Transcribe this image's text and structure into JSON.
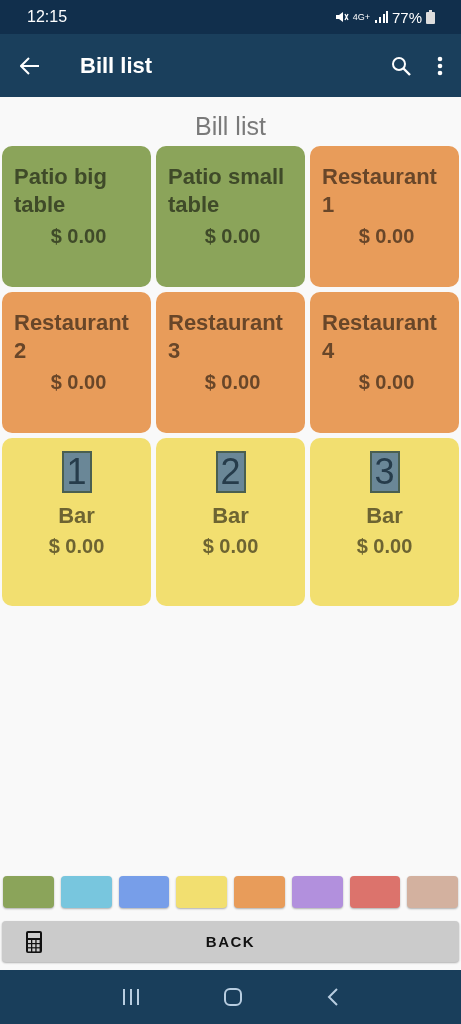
{
  "status_bar": {
    "time": "12:15",
    "network": "4G+",
    "battery": "77%"
  },
  "app_bar": {
    "title": "Bill list"
  },
  "page_title": "Bill list",
  "tiles": [
    {
      "kind": "table",
      "name": "Patio big table",
      "amount": "$ 0.00",
      "color": "#8ba45a"
    },
    {
      "kind": "table",
      "name": "Patio small table",
      "amount": "$ 0.00",
      "color": "#8ba45a"
    },
    {
      "kind": "table",
      "name": "Restaurant 1",
      "amount": "$ 0.00",
      "color": "#e89c5a"
    },
    {
      "kind": "table",
      "name": "Restaurant 2",
      "amount": "$ 0.00",
      "color": "#e89c5a"
    },
    {
      "kind": "table",
      "name": "Restaurant 3",
      "amount": "$ 0.00",
      "color": "#e89c5a"
    },
    {
      "kind": "table",
      "name": "Restaurant 4",
      "amount": "$ 0.00",
      "color": "#e89c5a"
    },
    {
      "kind": "bar",
      "number": "1",
      "name": "Bar",
      "amount": "$ 0.00",
      "color": "#f2df70"
    },
    {
      "kind": "bar",
      "number": "2",
      "name": "Bar",
      "amount": "$ 0.00",
      "color": "#f2df70"
    },
    {
      "kind": "bar",
      "number": "3",
      "name": "Bar",
      "amount": "$ 0.00",
      "color": "#f2df70"
    }
  ],
  "swatches": [
    {
      "color": "#8ba45a"
    },
    {
      "color": "#78c6de"
    },
    {
      "color": "#779ee9"
    },
    {
      "color": "#f2df70"
    },
    {
      "color": "#e89c5a"
    },
    {
      "color": "#b290dd"
    },
    {
      "color": "#dc736c"
    },
    {
      "color": "#d3b19f"
    }
  ],
  "back_button": {
    "label": "BACK"
  }
}
